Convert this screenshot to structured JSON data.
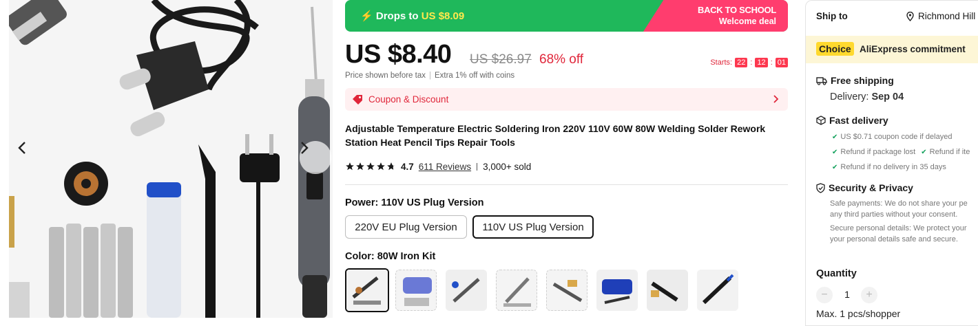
{
  "colors": {
    "promo_green": "#1fb85b",
    "promo_pink": "#ff3d6e",
    "sale_red": "#e0263a",
    "choice_yellow": "#ffd92e"
  },
  "gallery": {
    "prev_icon": "chevron-left-icon",
    "next_icon": "chevron-right-icon"
  },
  "promo": {
    "drops_prefix": "Drops to ",
    "drops_amount": "US $8.09",
    "banner_line1": "BACK TO SCHOOL",
    "banner_line2": "Welcome deal"
  },
  "price": {
    "current": "US $8.40",
    "original": "US $26.97",
    "discount": "68% off",
    "starts_label": "Starts:",
    "timer": [
      "22",
      "12",
      "01"
    ],
    "note_tax": "Price shown before tax",
    "note_coins": "Extra 1% off with coins"
  },
  "coupon": {
    "label": "Coupon & Discount"
  },
  "product": {
    "title": "Adjustable Temperature Electric Soldering Iron 220V 110V 60W 80W Welding Solder Rework Station Heat Pencil Tips Repair Tools",
    "rating": "4.7",
    "stars_filled": 4.7,
    "reviews": "611 Reviews",
    "sold": "3,000+ sold"
  },
  "options": {
    "power_label": "Power:",
    "power_value": "110V US Plug Version",
    "power_choices": [
      "220V EU Plug Version",
      "110V US Plug Version"
    ],
    "color_label": "Color:",
    "color_value": "80W Iron Kit",
    "color_swatch_count": 8
  },
  "panel": {
    "ship_to": "Ship to",
    "location": "Richmond Hill",
    "choice_badge": "Choice",
    "commitment": "AliExpress commitment",
    "free_shipping": "Free shipping",
    "delivery_label": "Delivery:",
    "delivery_date": "Sep 04",
    "fast_delivery": "Fast delivery",
    "fast_items": [
      "US $0.71 coupon code if delayed",
      "Refund if package lost",
      "Refund if ite",
      "Refund if no delivery in 35 days"
    ],
    "security": "Security & Privacy",
    "security_lines": [
      "Safe payments: We do not share your pe",
      "any third parties without your consent.",
      "Secure personal details: We protect your",
      "your personal details safe and secure."
    ],
    "quantity": "Quantity",
    "qty_value": "1",
    "max_note": "Max. 1 pcs/shopper"
  }
}
